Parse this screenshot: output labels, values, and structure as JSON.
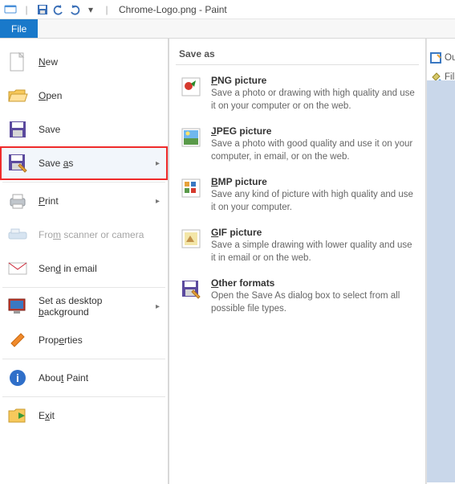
{
  "titlebar": {
    "filename": "Chrome-Logo.png - Paint"
  },
  "file_tab": "File",
  "menu": {
    "new": "New",
    "open": "Open",
    "save": "Save",
    "save_as": "Save as",
    "print": "Print",
    "scanner": "From scanner or camera",
    "send_email": "Send in email",
    "set_desktop": "Set as desktop background",
    "properties": "Properties",
    "about": "About Paint",
    "exit": "Exit"
  },
  "submenu": {
    "title": "Save as",
    "items": [
      {
        "title": "PNG picture",
        "desc": "Save a photo or drawing with high quality and use it on your computer or on the web."
      },
      {
        "title": "JPEG picture",
        "desc": "Save a photo with good quality and use it on your computer, in email, or on the web."
      },
      {
        "title": "BMP picture",
        "desc": "Save any kind of picture with high quality and use it on your computer."
      },
      {
        "title": "GIF picture",
        "desc": "Save a simple drawing with lower quality and use it in email or on the web."
      },
      {
        "title": "Other formats",
        "desc": "Open the Save As dialog box to select from all possible file types."
      }
    ]
  },
  "right_tools": {
    "outline": "Out",
    "fill": "Fill"
  }
}
